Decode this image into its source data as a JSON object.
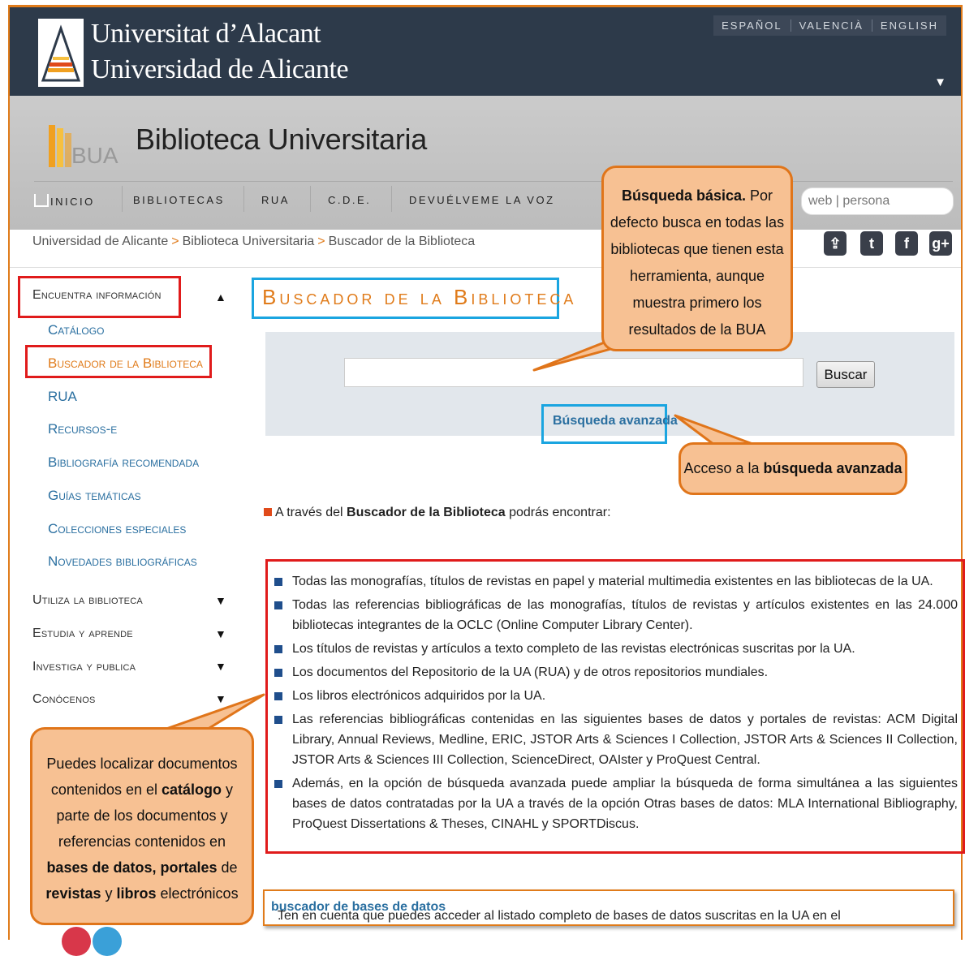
{
  "university": {
    "name_line1": "Universitat d’Alacant",
    "name_line2": "Universidad de Alicante",
    "languages": [
      "ESPAÑOL",
      "VALENCIÀ",
      "ENGLISH"
    ]
  },
  "library": {
    "title": "Biblioteca Universitaria",
    "logo_text": "BUA"
  },
  "nav": {
    "items": [
      "INICIO",
      "BIBLIOTECAS",
      "RUA",
      "C.D.E.",
      "DEVUÉLVEME LA VOZ"
    ],
    "search_placeholder": "web | persona"
  },
  "breadcrumb": {
    "items": [
      "Universidad de Alicante",
      "Biblioteca Universitaria",
      "Buscador de la Biblioteca"
    ],
    "separator": ">"
  },
  "social": [
    "share-icon",
    "twitter-icon",
    "facebook-icon",
    "google-plus-icon"
  ],
  "sidebar": {
    "section_active": "Encuentra información",
    "subitems": [
      "Catálogo",
      "Buscador de la Biblioteca",
      "RUA",
      "Recursos-e",
      "Bibliografía recomendada",
      "Guías temáticas",
      "Colecciones especiales",
      "Novedades bibliográficas"
    ],
    "sections": [
      "Utiliza la biblioteca",
      "Estudia y aprende",
      "Investiga y publica",
      "Conócenos"
    ]
  },
  "main": {
    "page_title": "Buscador de la Biblioteca",
    "search_button": "Buscar",
    "advanced_link": "Búsqueda avanzada",
    "intro_prefix": "A través del ",
    "intro_bold": "Buscador de la Biblioteca",
    "intro_suffix": " podrás encontrar:",
    "list": [
      "Todas las monografías, títulos de revistas en papel y material multimedia existentes en las bibliotecas de la UA.",
      "Todas las referencias bibliográficas de las monografías, títulos de revistas y artículos existentes en las 24.000 bibliotecas integrantes de la OCLC (Online Computer Library Center).",
      "Los títulos de revistas y artículos a texto completo de las revistas electrónicas suscritas por la UA.",
      "Los documentos del Repositorio de la UA (RUA) y de otros repositorios mundiales.",
      "Los libros electrónicos  adquiridos por la UA.",
      "Las referencias bibliográficas contenidas en las siguientes bases de datos y portales de revistas: ACM Digital Library, Annual Reviews, Medline, ERIC, JSTOR Arts & Sciences I Collection, JSTOR Arts & Sciences II Collection, JSTOR Arts & Sciences III Collection, ScienceDirect, OAIster y  ProQuest Central.",
      "Además, en la opción de búsqueda avanzada  puede ampliar la búsqueda de forma simultánea a las siguientes bases de datos contratadas por la UA a través de la opción Otras bases de datos: MLA International Bibliography, ProQuest Dissertations & Theses, CINAHL y SPORTDiscus."
    ],
    "note_text": "Ten en cuenta que puedes acceder al listado completo de bases de datos suscritas en la UA en el ",
    "note_link": "buscador de bases de datos",
    "note_end": "."
  },
  "callouts": {
    "basic_bold": "Búsqueda básica.",
    "basic_text": " Por defecto busca en todas las bibliotecas que tienen esta herramienta, aunque muestra primero los resultados de la BUA",
    "advanced_prefix": "Acceso a la ",
    "advanced_bold": "búsqueda avanzada",
    "left_p1": "Puedes localizar  documentos contenidos en el ",
    "left_b1": "catálogo",
    "left_p2": " y parte de los documentos y referencias contenidos en ",
    "left_b2": "bases de datos, portales",
    "left_p3": " de ",
    "left_b3": "revistas",
    "left_p4": " y ",
    "left_b4": "libros",
    "left_p5": " electrónicos"
  },
  "colors": {
    "header_bg": "#2d3a4a",
    "accent_orange": "#e07b1a",
    "link_blue": "#2a6fa0",
    "highlight_red": "#e01b1b",
    "highlight_blue": "#1aa5e0",
    "callout_fill": "#f7c193"
  }
}
